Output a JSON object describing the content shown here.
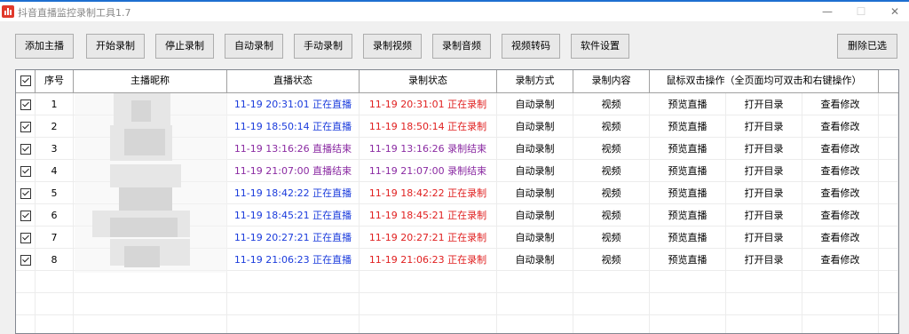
{
  "window": {
    "title": "抖音直播监控录制工具1.7",
    "minimize": "—",
    "maximize": "☐",
    "close": "✕"
  },
  "toolbar": {
    "add_host": "添加主播",
    "start_record": "开始录制",
    "stop_record": "停止录制",
    "auto_record": "自动录制",
    "manual_record": "手动录制",
    "record_video": "录制视频",
    "record_audio": "录制音频",
    "video_transcode": "视频转码",
    "software_settings": "软件设置",
    "delete_selected": "删除已选"
  },
  "table": {
    "columns": {
      "index": "序号",
      "nickname": "主播昵称",
      "live_status": "直播状态",
      "record_status": "录制状态",
      "record_mode": "录制方式",
      "record_content": "录制内容",
      "actions": "鼠标双击操作（全页面均可双击和右键操作）"
    },
    "rows": [
      {
        "index": "1",
        "live": "11-19 20:31:01 正在直播",
        "live_state": "live",
        "rec": "11-19 20:31:01 正在录制",
        "rec_state": "rec",
        "mode": "自动录制",
        "content": "视频",
        "a1": "预览直播",
        "a2": "打开目录",
        "a3": "查看修改"
      },
      {
        "index": "2",
        "live": "11-19 18:50:14 正在直播",
        "live_state": "live",
        "rec": "11-19 18:50:14 正在录制",
        "rec_state": "rec",
        "mode": "自动录制",
        "content": "视频",
        "a1": "预览直播",
        "a2": "打开目录",
        "a3": "查看修改"
      },
      {
        "index": "3",
        "live": "11-19 13:16:26 直播结束",
        "live_state": "ended",
        "rec": "11-19 13:16:26 录制结束",
        "rec_state": "ended",
        "mode": "自动录制",
        "content": "视频",
        "a1": "预览直播",
        "a2": "打开目录",
        "a3": "查看修改"
      },
      {
        "index": "4",
        "live": "11-19 21:07:00 直播结束",
        "live_state": "ended",
        "rec": "11-19 21:07:00 录制结束",
        "rec_state": "ended",
        "mode": "自动录制",
        "content": "视频",
        "a1": "预览直播",
        "a2": "打开目录",
        "a3": "查看修改"
      },
      {
        "index": "5",
        "live": "11-19 18:42:22 正在直播",
        "live_state": "live",
        "rec": "11-19 18:42:22 正在录制",
        "rec_state": "rec",
        "mode": "自动录制",
        "content": "视频",
        "a1": "预览直播",
        "a2": "打开目录",
        "a3": "查看修改"
      },
      {
        "index": "6",
        "live": "11-19 18:45:21 正在直播",
        "live_state": "live",
        "rec": "11-19 18:45:21 正在录制",
        "rec_state": "rec",
        "mode": "自动录制",
        "content": "视频",
        "a1": "预览直播",
        "a2": "打开目录",
        "a3": "查看修改"
      },
      {
        "index": "7",
        "live": "11-19 20:27:21 正在直播",
        "live_state": "live",
        "rec": "11-19 20:27:21 正在录制",
        "rec_state": "rec",
        "mode": "自动录制",
        "content": "视频",
        "a1": "预览直播",
        "a2": "打开目录",
        "a3": "查看修改"
      },
      {
        "index": "8",
        "live": "11-19 21:06:23 正在直播",
        "live_state": "live",
        "rec": "11-19 21:06:23 正在录制",
        "rec_state": "rec",
        "mode": "自动录制",
        "content": "视频",
        "a1": "预览直播",
        "a2": "打开目录",
        "a3": "查看修改"
      }
    ]
  },
  "colors": {
    "live": "#1a3bdc",
    "ended": "#8a2aa2",
    "recording": "#e02020",
    "app_icon": "#e0392b"
  }
}
